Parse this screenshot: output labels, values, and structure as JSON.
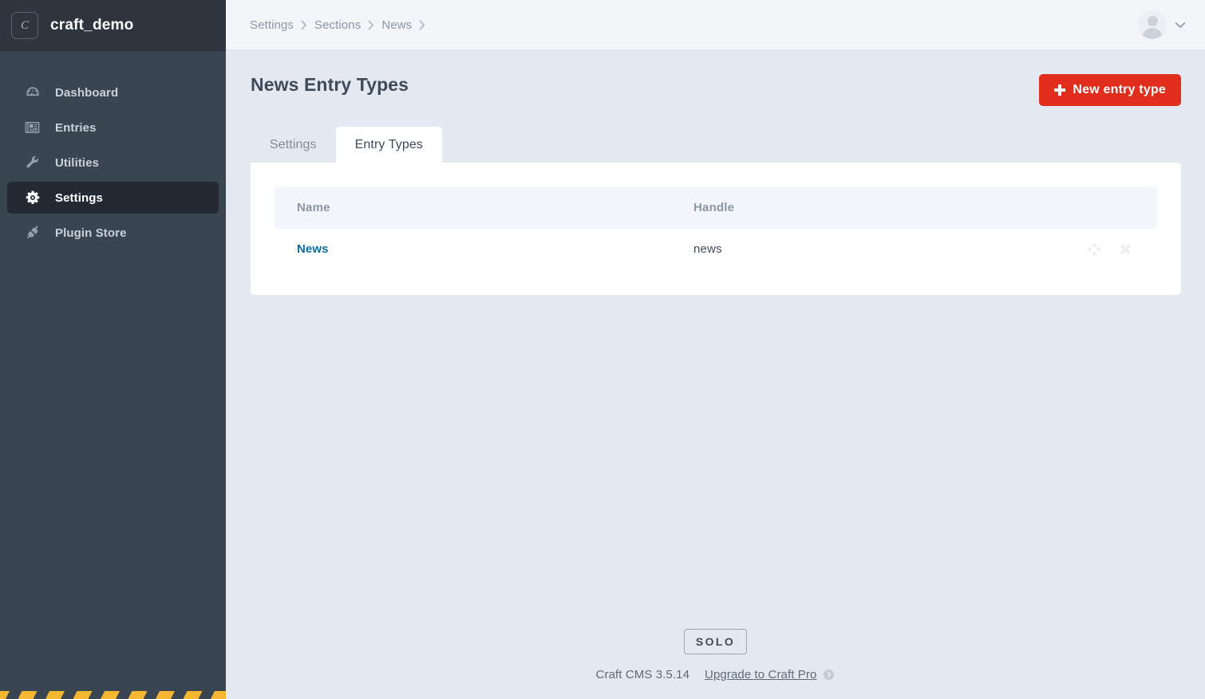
{
  "sidebar": {
    "logo_badge": "C",
    "site_name": "craft_demo",
    "items": [
      {
        "label": "Dashboard",
        "icon": "gauge-icon",
        "active": false
      },
      {
        "label": "Entries",
        "icon": "newspaper-icon",
        "active": false
      },
      {
        "label": "Utilities",
        "icon": "wrench-icon",
        "active": false
      },
      {
        "label": "Settings",
        "icon": "gear-icon",
        "active": true
      },
      {
        "label": "Plugin Store",
        "icon": "plug-icon",
        "active": false
      }
    ]
  },
  "topbar": {
    "breadcrumb": [
      "Settings",
      "Sections",
      "News"
    ],
    "account_icon": "user-avatar",
    "chevron_icon": "chevron-down-icon"
  },
  "page": {
    "title": "News Entry Types",
    "new_button_label": "New entry type",
    "new_button_icon": "plus-icon",
    "accent_color": "#e12d1b"
  },
  "tabs": [
    {
      "label": "Settings",
      "active": false
    },
    {
      "label": "Entry Types",
      "active": true
    }
  ],
  "table": {
    "columns": [
      "Name",
      "Handle"
    ],
    "rows": [
      {
        "name": "News",
        "handle": "news",
        "move_icon": "move-handle-icon",
        "delete_icon": "close-icon"
      }
    ]
  },
  "footer": {
    "edition": "SOLO",
    "version": "Craft CMS 3.5.14",
    "upgrade_label": "Upgrade to Craft Pro",
    "upgrade_icon": "arrow-circle-right-icon"
  }
}
